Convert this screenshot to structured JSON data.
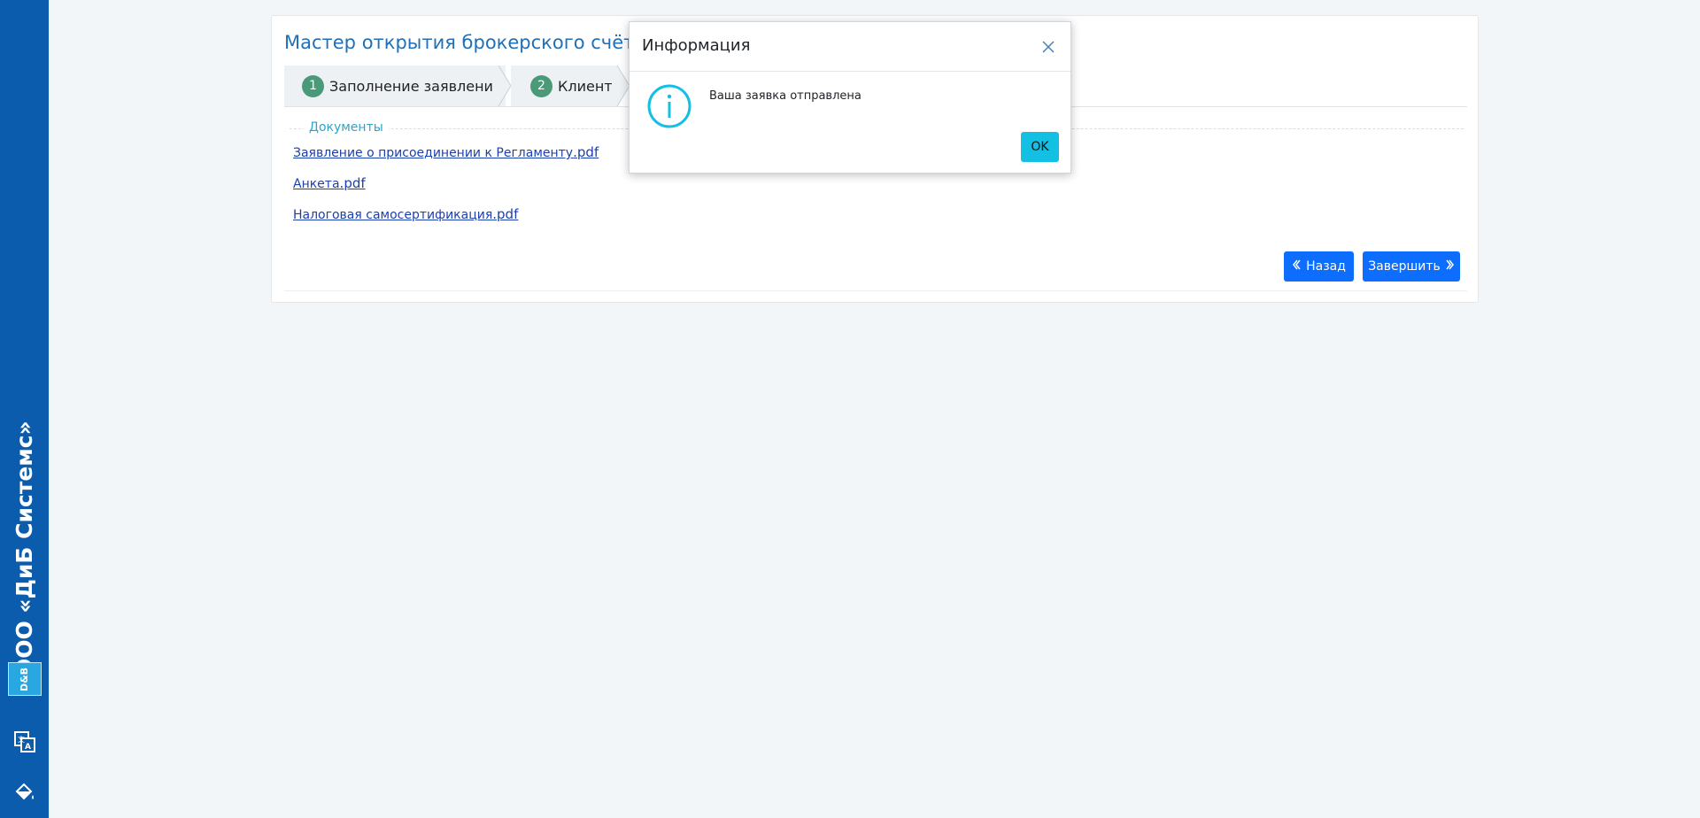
{
  "sidebar": {
    "brand_name": "ООО «ДиБ Системс»",
    "logo_text": "D&B",
    "icons": [
      "translate-icon",
      "paint-bucket-icon"
    ]
  },
  "wizard": {
    "title": "Мастер открытия брокерского счёта",
    "steps": [
      {
        "number": "1",
        "label": "Заполнение заявления"
      },
      {
        "number": "2",
        "label": "Клиент"
      }
    ]
  },
  "documents": {
    "legend": "Документы",
    "links": [
      {
        "name": "Заявление о присоединении к Регламенту",
        "ext": ".pdf"
      },
      {
        "name": "Анкета",
        "ext": ".pdf"
      },
      {
        "name": "Налоговая самосертификация",
        "ext": ".pdf"
      }
    ]
  },
  "actions": {
    "back_label": "Назад",
    "finish_label": "Завершить"
  },
  "modal": {
    "title": "Информация",
    "message": "Ваша заявка отправлена",
    "ok_label": "OK"
  },
  "colors": {
    "sidebar": "#0b5cad",
    "primary": "#0d6efd",
    "info": "#13c0e4",
    "step_badge": "#4a9a79",
    "title": "#1f70b8"
  }
}
